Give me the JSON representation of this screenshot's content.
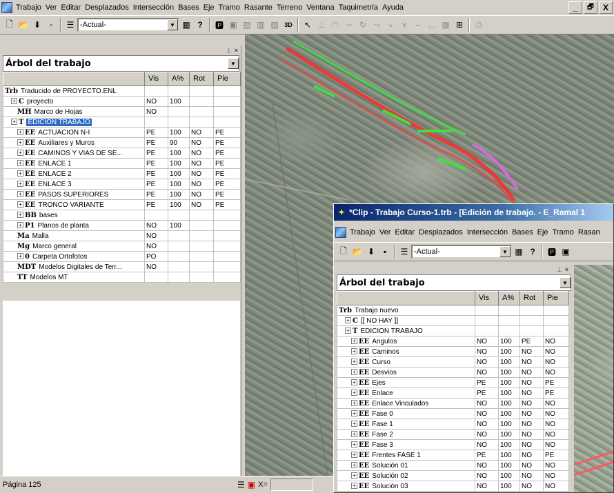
{
  "main_menu": [
    "Trabajo",
    "Ver",
    "Editar",
    "Desplazados",
    "Intersección",
    "Bases",
    "Eje",
    "Tramo",
    "Rasante",
    "Terreno",
    "Ventana",
    "Taquimetría",
    "Ayuda"
  ],
  "window_controls": {
    "minimize": "_",
    "restore": "🗗",
    "close": "X"
  },
  "toolbar": {
    "combo_value": "-Actual-",
    "help_glyph": "?",
    "btn_3d": "3D"
  },
  "tree_panel": {
    "title": "Árbol del trabajo",
    "columns": [
      "",
      "Vis",
      "A%",
      "Rot",
      "Pie"
    ],
    "rows": [
      {
        "tag": "Trb",
        "label": "Traducido de PROYECTO.ENL",
        "vis": "",
        "a": "",
        "rot": "",
        "pie": ""
      },
      {
        "tag": "C",
        "label": "proyecto",
        "vis": "NO",
        "a": "100",
        "rot": "",
        "pie": ""
      },
      {
        "tag": "MH",
        "label": "Marco de Hojas",
        "vis": "NO",
        "a": "",
        "rot": "",
        "pie": ""
      },
      {
        "tag": "T",
        "label": "EDICION TRABAJO",
        "vis": "",
        "a": "",
        "rot": "",
        "pie": ""
      },
      {
        "tag": "EE",
        "label": "ACTUACION N-I",
        "vis": "PE",
        "a": "100",
        "rot": "NO",
        "pie": "PE"
      },
      {
        "tag": "EE",
        "label": "Auxiliares y Muros",
        "vis": "PE",
        "a": "90",
        "rot": "NO",
        "pie": "PE"
      },
      {
        "tag": "EE",
        "label": "CAMINOS Y VIAS DE SE...",
        "vis": "PE",
        "a": "100",
        "rot": "NO",
        "pie": "PE"
      },
      {
        "tag": "EE",
        "label": "ENLACE 1",
        "vis": "PE",
        "a": "100",
        "rot": "NO",
        "pie": "PE"
      },
      {
        "tag": "EE",
        "label": "ENLACE 2",
        "vis": "PE",
        "a": "100",
        "rot": "NO",
        "pie": "PE"
      },
      {
        "tag": "EE",
        "label": "ENLACE 3",
        "vis": "PE",
        "a": "100",
        "rot": "NO",
        "pie": "PE"
      },
      {
        "tag": "EE",
        "label": "PASOS SUPERIORES",
        "vis": "PE",
        "a": "100",
        "rot": "NO",
        "pie": "PE"
      },
      {
        "tag": "EE",
        "label": "TRONCO VARIANTE",
        "vis": "PE",
        "a": "100",
        "rot": "NO",
        "pie": "PE"
      },
      {
        "tag": "BB",
        "label": "bases",
        "vis": "",
        "a": "",
        "rot": "",
        "pie": ""
      },
      {
        "tag": "P1",
        "label": "Planos de planta",
        "vis": "NO",
        "a": "100",
        "rot": "",
        "pie": ""
      },
      {
        "tag": "Ma",
        "label": "Malla",
        "vis": "NO",
        "a": "",
        "rot": "",
        "pie": ""
      },
      {
        "tag": "Mg",
        "label": "Marco general",
        "vis": "NO",
        "a": "",
        "rot": "",
        "pie": ""
      },
      {
        "tag": "0",
        "label": "Carpeta Ortofotos",
        "vis": "PO",
        "a": "",
        "rot": "",
        "pie": ""
      },
      {
        "tag": "MDT",
        "label": "Modelos Digitales de Terr...",
        "vis": "NO",
        "a": "",
        "rot": "",
        "pie": ""
      },
      {
        "tag": "TT",
        "label": "Modelos MT",
        "vis": "",
        "a": "",
        "rot": "",
        "pie": ""
      }
    ]
  },
  "status_bar": {
    "page": "Página 125",
    "x_label": "X="
  },
  "child_window": {
    "title": "*Clip - Trabajo Curso-1.trb - [Edición de trabajo. - E_Ramal 1",
    "menu": [
      "Trabajo",
      "Ver",
      "Editar",
      "Desplazados",
      "Intersección",
      "Bases",
      "Eje",
      "Tramo",
      "Rasan"
    ],
    "combo_value": "-Actual-",
    "help_glyph": "?",
    "tree_title": "Árbol del trabajo",
    "columns": [
      "",
      "Vis",
      "A%",
      "Rot",
      "Pie"
    ],
    "rows": [
      {
        "tag": "Trb",
        "label": "Trabajo nuevo",
        "vis": "",
        "a": "",
        "rot": "",
        "pie": ""
      },
      {
        "tag": "C",
        "label": "[[ NO HAY ]]",
        "vis": "",
        "a": "",
        "rot": "",
        "pie": ""
      },
      {
        "tag": "T",
        "label": "EDICION TRABAJO",
        "vis": "",
        "a": "",
        "rot": "",
        "pie": ""
      },
      {
        "tag": "EE",
        "label": "Angulos",
        "vis": "NO",
        "a": "100",
        "rot": "PE",
        "pie": "NO"
      },
      {
        "tag": "EE",
        "label": "Caminos",
        "vis": "NO",
        "a": "100",
        "rot": "NO",
        "pie": "NO"
      },
      {
        "tag": "EE",
        "label": "Curso",
        "vis": "NO",
        "a": "100",
        "rot": "NO",
        "pie": "NO"
      },
      {
        "tag": "EE",
        "label": "Desvios",
        "vis": "NO",
        "a": "100",
        "rot": "NO",
        "pie": "NO"
      },
      {
        "tag": "EE",
        "label": "Ejes",
        "vis": "PE",
        "a": "100",
        "rot": "NO",
        "pie": "PE"
      },
      {
        "tag": "EE",
        "label": "Enlace",
        "vis": "PE",
        "a": "100",
        "rot": "NO",
        "pie": "PE"
      },
      {
        "tag": "EE",
        "label": "Enlace Vinculados",
        "vis": "NO",
        "a": "100",
        "rot": "NO",
        "pie": "NO"
      },
      {
        "tag": "EE",
        "label": "Fase 0",
        "vis": "NO",
        "a": "100",
        "rot": "NO",
        "pie": "NO"
      },
      {
        "tag": "EE",
        "label": "Fase 1",
        "vis": "NO",
        "a": "100",
        "rot": "NO",
        "pie": "NO"
      },
      {
        "tag": "EE",
        "label": "Fase 2",
        "vis": "NO",
        "a": "100",
        "rot": "NO",
        "pie": "NO"
      },
      {
        "tag": "EE",
        "label": "Fase 3",
        "vis": "NO",
        "a": "100",
        "rot": "NO",
        "pie": "NO"
      },
      {
        "tag": "EE",
        "label": "Frentes FASE 1",
        "vis": "PE",
        "a": "100",
        "rot": "NO",
        "pie": "PE"
      },
      {
        "tag": "EE",
        "label": "Solución 01",
        "vis": "NO",
        "a": "100",
        "rot": "NO",
        "pie": "NO"
      },
      {
        "tag": "EE",
        "label": "Solución 02",
        "vis": "NO",
        "a": "100",
        "rot": "NO",
        "pie": "NO"
      },
      {
        "tag": "EE",
        "label": "Solución 03",
        "vis": "NO",
        "a": "100",
        "rot": "NO",
        "pie": "NO"
      }
    ]
  }
}
